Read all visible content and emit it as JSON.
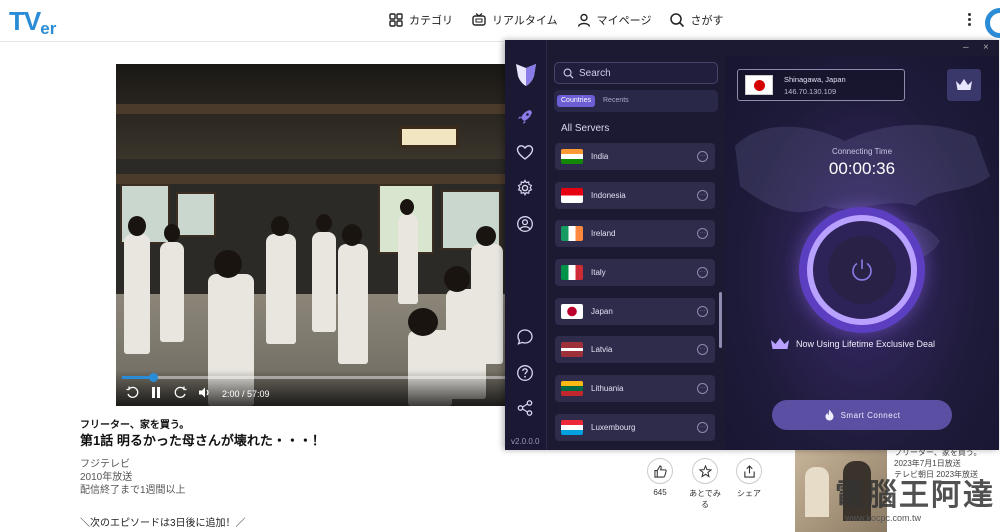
{
  "tver": {
    "logo_main": "TV",
    "logo_sub": "er",
    "nav": [
      {
        "label": "カテゴリ",
        "icon": "grid-icon"
      },
      {
        "label": "リアルタイム",
        "icon": "tv-icon"
      },
      {
        "label": "マイページ",
        "icon": "user-icon"
      },
      {
        "label": "さがす",
        "icon": "search-icon"
      }
    ],
    "player": {
      "time": "2:00 / 57:09",
      "progress": 0.08
    },
    "episode": {
      "series": "フリーター、家を買う。",
      "title": "第1話 明るかった母さんが壊れた・・・！",
      "broadcaster": "フジテレビ",
      "aired": "2010年放送",
      "availability": "配信終了まで1週間以上",
      "next": "＼次のエピソードは3日後に追加！／"
    },
    "actions": [
      {
        "label": "645",
        "icon": "thumbs-up-icon"
      },
      {
        "label": "あとでみる",
        "icon": "bookmark-icon"
      },
      {
        "label": "シェア",
        "icon": "share-icon"
      }
    ],
    "recommend": {
      "lines": [
        "フリーター、家を買う。",
        "2023年7月1日放送",
        "テレビ朝日 2023年放送"
      ]
    },
    "watermark": "電腦王阿達",
    "watermark_url": "www.kocpc.com.tw"
  },
  "vpn": {
    "version": "v2.0.0.0",
    "search_placeholder": "Search",
    "tabs": [
      "Countries",
      "Recents"
    ],
    "section_title": "All Servers",
    "servers": [
      {
        "name": "India",
        "flag": "india"
      },
      {
        "name": "Indonesia",
        "flag": "indonesia"
      },
      {
        "name": "Ireland",
        "flag": "ireland"
      },
      {
        "name": "Italy",
        "flag": "italy"
      },
      {
        "name": "Japan",
        "flag": "japan"
      },
      {
        "name": "Latvia",
        "flag": "latvia"
      },
      {
        "name": "Lithuania",
        "flag": "lithuania"
      },
      {
        "name": "Luxembourg",
        "flag": "luxembourg"
      }
    ],
    "location": {
      "city": "Shinagawa, Japan",
      "ip": "146.70.130.109"
    },
    "connecting_label": "Connecting Time",
    "connecting_time": "00:00:36",
    "deal_text": "Now Using Lifetime Exclusive Deal",
    "smart_connect": "Smart Connect",
    "colors": {
      "accent": "#6c5fd6",
      "bg": "#1c1a33",
      "ring": "#b9a2ff"
    }
  }
}
